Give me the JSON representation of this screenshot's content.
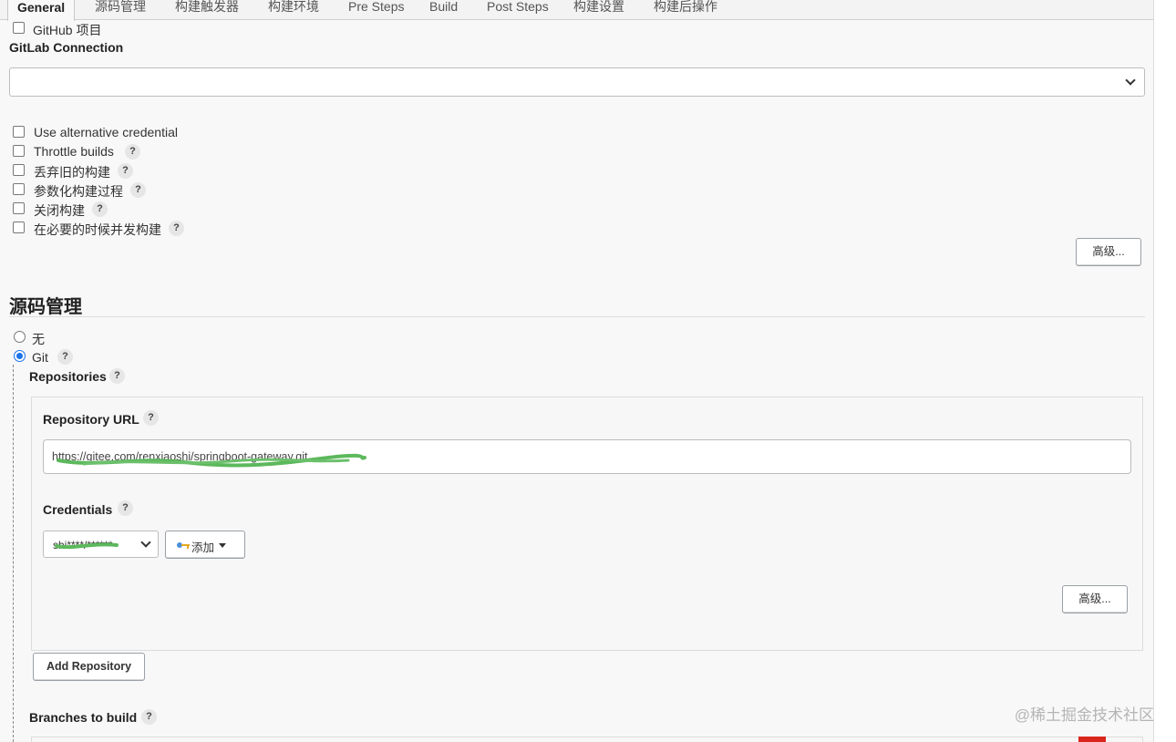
{
  "tabs": [
    {
      "label": "General",
      "active": true
    },
    {
      "label": "源码管理"
    },
    {
      "label": "构建触发器"
    },
    {
      "label": "构建环境"
    },
    {
      "label": "Pre Steps"
    },
    {
      "label": "Build"
    },
    {
      "label": "Post Steps"
    },
    {
      "label": "构建设置"
    },
    {
      "label": "构建后操作"
    }
  ],
  "general": {
    "github_project_label": "GitHub 项目",
    "gitlab_connection_label": "GitLab Connection",
    "gitlab_connection_value": "",
    "options": [
      {
        "label": "Use alternative credential",
        "help": false,
        "checked": false
      },
      {
        "label": "Throttle builds",
        "help": true,
        "checked": false
      },
      {
        "label": "丢弃旧的构建",
        "help": true,
        "checked": false
      },
      {
        "label": "参数化构建过程",
        "help": true,
        "checked": false
      },
      {
        "label": "关闭构建",
        "help": true,
        "checked": false
      },
      {
        "label": "在必要的时候并发构建",
        "help": true,
        "checked": false
      }
    ],
    "advanced_button": "高级..."
  },
  "scm": {
    "title": "源码管理",
    "none_label": "无",
    "git_label": "Git",
    "selected": "git",
    "repositories_label": "Repositories",
    "repository_url_label": "Repository URL",
    "repository_url_value": "https://gitee.com/renxiaoshi/springboot-gateway.git",
    "credentials_label": "Credentials",
    "credentials_value": "shi****/******",
    "add_button": "添加",
    "advanced_button": "高级...",
    "add_repository_button": "Add Repository",
    "branches_label": "Branches to build"
  },
  "help_glyph": "?",
  "watermark": "@稀土掘金技术社区",
  "colors": {
    "accent": "#1a73e8",
    "redaction": "#5cb85c"
  }
}
